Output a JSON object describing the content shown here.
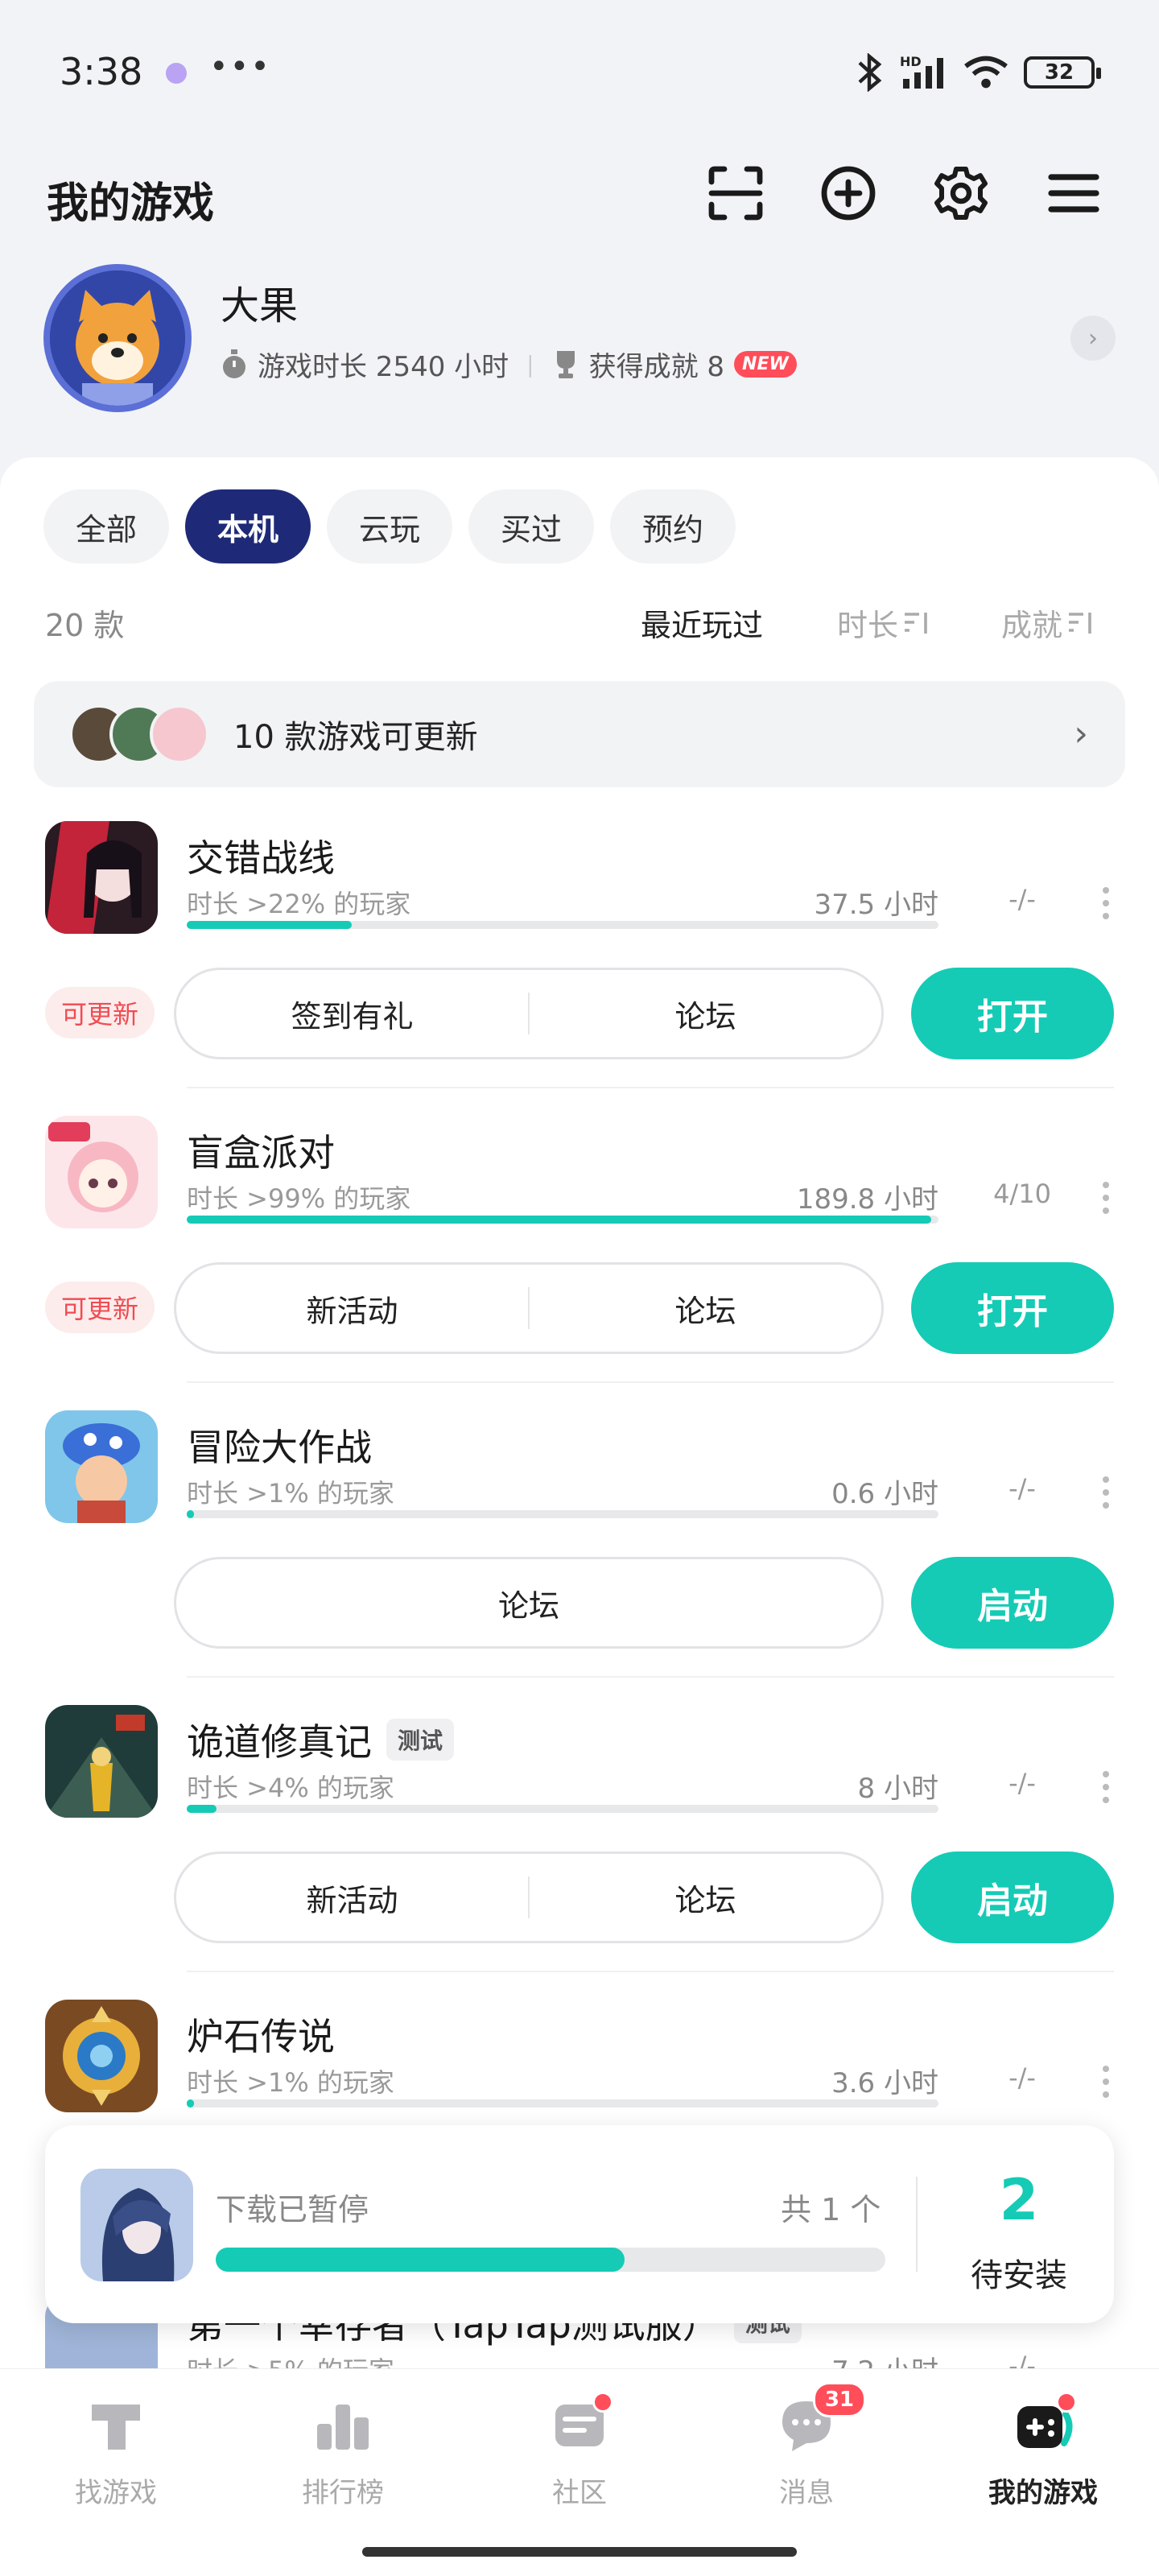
{
  "status_bar": {
    "time": "3:38",
    "more": "•••",
    "net": "HD",
    "battery": "32"
  },
  "header": {
    "title": "我的游戏"
  },
  "profile": {
    "name": "大果",
    "playtime": "游戏时长 2540 小时",
    "sep": "|",
    "achievements": "获得成就 8",
    "new_badge": "NEW"
  },
  "filters": [
    "全部",
    "本机",
    "云玩",
    "买过",
    "预约"
  ],
  "sort": {
    "count": "20 款",
    "recent": "最近玩过",
    "duration": "时长",
    "achievement": "成就"
  },
  "update_bar": {
    "text": "10 款游戏可更新"
  },
  "games": [
    {
      "name": "交错战线",
      "sub": "时长 >22% 的玩家",
      "hours": "37.5 小时",
      "ach": "-/-",
      "progress": 0.22,
      "badge": "可更新",
      "buttons": [
        "签到有礼",
        "论坛"
      ],
      "action": "打开"
    },
    {
      "name": "盲盒派对",
      "sub": "时长 >99% 的玩家",
      "hours": "189.8 小时",
      "ach": "4/10",
      "progress": 0.99,
      "badge": "可更新",
      "buttons": [
        "新活动",
        "论坛"
      ],
      "action": "打开"
    },
    {
      "name": "冒险大作战",
      "sub": "时长 >1% 的玩家",
      "hours": "0.6 小时",
      "ach": "-/-",
      "progress": 0.01,
      "badge": "",
      "buttons": [
        "论坛"
      ],
      "action": "启动"
    },
    {
      "name": "诡道修真记",
      "tag": "测试",
      "sub": "时长 >4% 的玩家",
      "hours": "8 小时",
      "ach": "-/-",
      "progress": 0.04,
      "badge": "",
      "buttons": [
        "新活动",
        "论坛"
      ],
      "action": "启动"
    },
    {
      "name": "炉石传说",
      "sub": "时长 >1% 的玩家",
      "hours": "3.6 小时",
      "ach": "-/-",
      "progress": 0.01
    }
  ],
  "partial_row": {
    "name": "第一个幸存者（TapTap测试服）",
    "tag": "测试",
    "sub": "时长 >5% 的玩家",
    "hours": "7.2 小时",
    "ach": "-/-"
  },
  "download": {
    "title": "下载已暂停",
    "count": "共 1 个",
    "progress": 0.61,
    "pending_num": "2",
    "pending_label": "待安装"
  },
  "nav": [
    {
      "label": "找游戏"
    },
    {
      "label": "排行榜"
    },
    {
      "label": "社区"
    },
    {
      "label": "消息",
      "badge": "31"
    },
    {
      "label": "我的游戏"
    }
  ]
}
